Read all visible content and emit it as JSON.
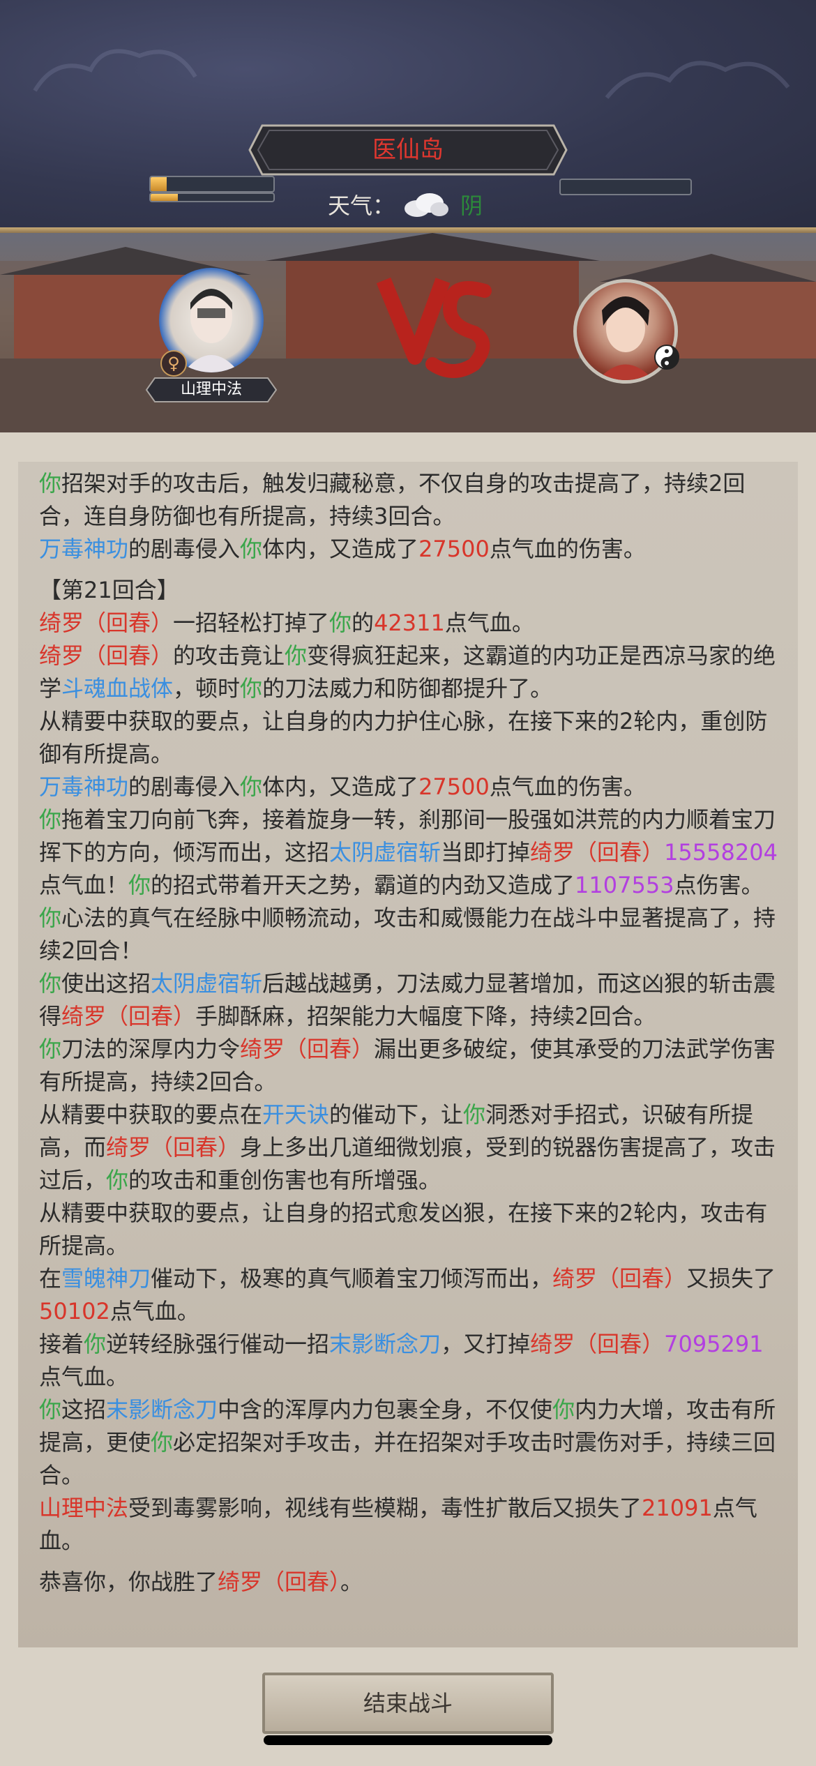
{
  "location": {
    "name": "医仙岛"
  },
  "weather": {
    "label": "天气：",
    "value": "阴",
    "icon": "cloud-icon"
  },
  "player": {
    "name": "山理中法",
    "gender_icon": "♀"
  },
  "log": [
    {
      "gap": false,
      "segments": [
        {
          "t": "你",
          "c": "g"
        },
        {
          "t": "招架对手的攻击后，触发归藏秘意，不仅自身的攻击提高了，持续2回合，连自身防御也有所提高，持续3回合。"
        }
      ]
    },
    {
      "gap": false,
      "segments": [
        {
          "t": "万毒神功",
          "c": "b"
        },
        {
          "t": "的剧毒侵入"
        },
        {
          "t": "你",
          "c": "g"
        },
        {
          "t": "体内，又造成了"
        },
        {
          "t": "27500",
          "c": "r"
        },
        {
          "t": "点气血的伤害。"
        }
      ]
    },
    {
      "gap": true,
      "segments": [
        {
          "t": "【第21回合】"
        }
      ]
    },
    {
      "gap": false,
      "segments": [
        {
          "t": "绮罗（回春）",
          "c": "r"
        },
        {
          "t": "一招轻松打掉了"
        },
        {
          "t": "你",
          "c": "g"
        },
        {
          "t": "的"
        },
        {
          "t": "42311",
          "c": "r"
        },
        {
          "t": "点气血。"
        }
      ]
    },
    {
      "gap": false,
      "segments": [
        {
          "t": "绮罗（回春）",
          "c": "r"
        },
        {
          "t": "的攻击竟让"
        },
        {
          "t": "你",
          "c": "g"
        },
        {
          "t": "变得疯狂起来，这霸道的内功正是西凉马家的绝学"
        },
        {
          "t": "斗魂血战体",
          "c": "b"
        },
        {
          "t": "，顿时"
        },
        {
          "t": "你",
          "c": "g"
        },
        {
          "t": "的刀法威力和防御都提升了。"
        }
      ]
    },
    {
      "gap": false,
      "segments": [
        {
          "t": "从精要中获取的要点，让自身的内力护住心脉，在接下来的2轮内，重创防御有所提高。"
        }
      ]
    },
    {
      "gap": false,
      "segments": [
        {
          "t": "万毒神功",
          "c": "b"
        },
        {
          "t": "的剧毒侵入"
        },
        {
          "t": "你",
          "c": "g"
        },
        {
          "t": "体内，又造成了"
        },
        {
          "t": "27500",
          "c": "r"
        },
        {
          "t": "点气血的伤害。"
        }
      ]
    },
    {
      "gap": false,
      "segments": [
        {
          "t": "你",
          "c": "g"
        },
        {
          "t": "拖着宝刀向前飞奔，接着旋身一转，刹那间一股强如洪荒的内力顺着宝刀挥下的方向，倾泻而出，这招"
        },
        {
          "t": "太阴虚宿斩",
          "c": "b"
        },
        {
          "t": "当即打掉"
        },
        {
          "t": "绮罗（回春）",
          "c": "r"
        },
        {
          "t": "15558204",
          "c": "m"
        },
        {
          "t": "点气血！"
        },
        {
          "t": "你",
          "c": "g"
        },
        {
          "t": "的招式带着开天之势，霸道的内劲又造成了"
        },
        {
          "t": "1107553",
          "c": "m"
        },
        {
          "t": "点伤害。"
        },
        {
          "t": "你",
          "c": "g"
        },
        {
          "t": "心法的真气在经脉中顺畅流动，攻击和威慑能力在战斗中显著提高了，持续2回合！"
        }
      ]
    },
    {
      "gap": false,
      "segments": [
        {
          "t": "你",
          "c": "g"
        },
        {
          "t": "使出这招"
        },
        {
          "t": "太阴虚宿斩",
          "c": "b"
        },
        {
          "t": "后越战越勇，刀法威力显著增加，而这凶狠的斩击震得"
        },
        {
          "t": "绮罗（回春）",
          "c": "r"
        },
        {
          "t": "手脚酥麻，招架能力大幅度下降，持续2回合。"
        }
      ]
    },
    {
      "gap": false,
      "segments": [
        {
          "t": "你",
          "c": "g"
        },
        {
          "t": "刀法的深厚内力令"
        },
        {
          "t": "绮罗（回春）",
          "c": "r"
        },
        {
          "t": "漏出更多破绽，使其承受的刀法武学伤害有所提高，持续2回合。"
        }
      ]
    },
    {
      "gap": false,
      "segments": [
        {
          "t": "从精要中获取的要点在"
        },
        {
          "t": "开天诀",
          "c": "b"
        },
        {
          "t": "的催动下，让"
        },
        {
          "t": "你",
          "c": "g"
        },
        {
          "t": "洞悉对手招式，识破有所提高，而"
        },
        {
          "t": "绮罗（回春）",
          "c": "r"
        },
        {
          "t": "身上多出几道细微划痕，受到的锐器伤害提高了，攻击过后，"
        },
        {
          "t": "你",
          "c": "g"
        },
        {
          "t": "的攻击和重创伤害也有所增强。"
        }
      ]
    },
    {
      "gap": false,
      "segments": [
        {
          "t": "从精要中获取的要点，让自身的招式愈发凶狠，在接下来的2轮内，攻击有所提高。"
        }
      ]
    },
    {
      "gap": false,
      "segments": [
        {
          "t": "在"
        },
        {
          "t": "雪魄神刀",
          "c": "b"
        },
        {
          "t": "催动下，极寒的真气顺着宝刀倾泻而出，"
        },
        {
          "t": "绮罗（回春）",
          "c": "r"
        },
        {
          "t": "又损失了"
        },
        {
          "t": "50102",
          "c": "r"
        },
        {
          "t": "点气血。"
        }
      ]
    },
    {
      "gap": false,
      "segments": [
        {
          "t": "接着"
        },
        {
          "t": "你",
          "c": "g"
        },
        {
          "t": "逆转经脉强行催动一招"
        },
        {
          "t": "末影断念刀",
          "c": "b"
        },
        {
          "t": "，又打掉"
        },
        {
          "t": "绮罗（回春）",
          "c": "r"
        },
        {
          "t": "7095291",
          "c": "m"
        },
        {
          "t": "点气血。"
        }
      ]
    },
    {
      "gap": false,
      "segments": [
        {
          "t": "你",
          "c": "g"
        },
        {
          "t": "这招"
        },
        {
          "t": "末影断念刀",
          "c": "b"
        },
        {
          "t": "中含的浑厚内力包裹全身，不仅使"
        },
        {
          "t": "你",
          "c": "g"
        },
        {
          "t": "内力大增，攻击有所提高，更使"
        },
        {
          "t": "你",
          "c": "g"
        },
        {
          "t": "必定招架对手攻击，并在招架对手攻击时震伤对手，持续三回合。"
        }
      ]
    },
    {
      "gap": false,
      "segments": [
        {
          "t": "山理中法",
          "c": "r"
        },
        {
          "t": "受到毒雾影响，视线有些模糊，毒性扩散后又损失了"
        },
        {
          "t": "21091",
          "c": "r"
        },
        {
          "t": "点气血。"
        }
      ]
    },
    {
      "gap": true,
      "segments": [
        {
          "t": "恭喜你，你战胜了"
        },
        {
          "t": "绮罗（回春）",
          "c": "r"
        },
        {
          "t": "。"
        }
      ]
    }
  ],
  "end_button": {
    "label": "结束战斗"
  },
  "colors": {
    "ally": "#3aa64a",
    "skill": "#3a8fe0",
    "enemy": "#d8352a",
    "big_damage": "#b23fe0"
  },
  "bars": {
    "player_hp": 0.13,
    "player_mp": 0.22,
    "enemy_hp": 0.0
  }
}
